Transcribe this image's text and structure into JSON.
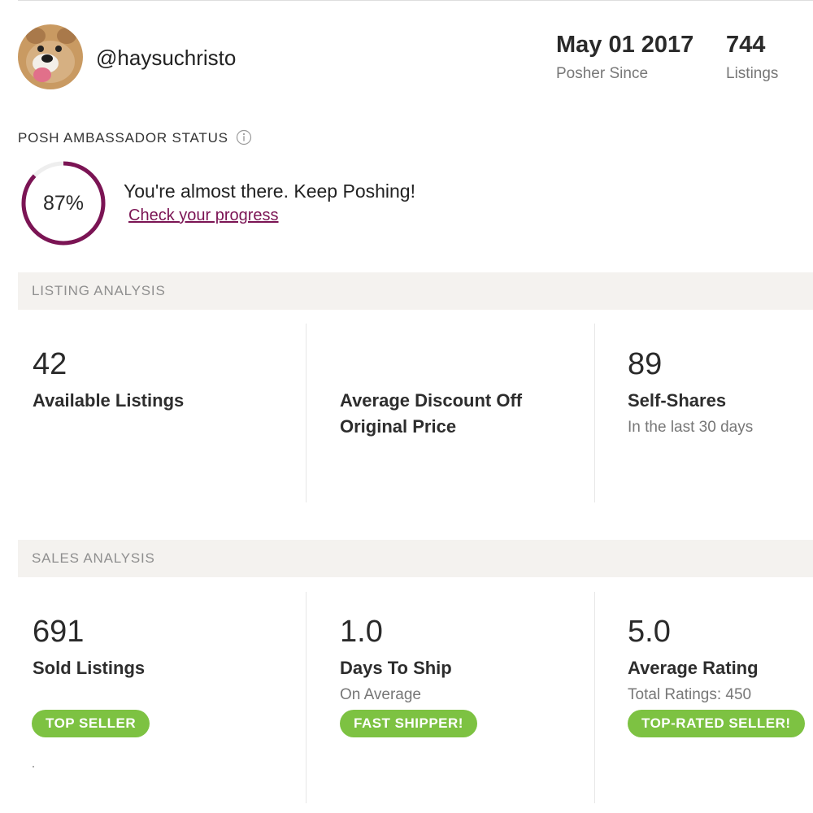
{
  "profile": {
    "username": "@haysuchristo",
    "posher_since_value": "May 01 2017",
    "posher_since_label": "Posher Since",
    "listings_value": "744",
    "listings_label": "Listings"
  },
  "ambassador": {
    "title": "POSH AMBASSADOR STATUS",
    "progress_percent": 87,
    "progress_text": "87%",
    "message": "You're almost there. Keep Poshing!",
    "link": "Check your progress",
    "accent_color": "#7b1454"
  },
  "listing_analysis": {
    "header": "LISTING ANALYSIS",
    "available_value": "42",
    "available_label": "Available Listings",
    "discount_label_line1": "Average Discount Off",
    "discount_label_line2": "Original Price",
    "self_shares_value": "89",
    "self_shares_label": "Self-Shares",
    "self_shares_sub": "In the last 30 days"
  },
  "sales_analysis": {
    "header": "SALES ANALYSIS",
    "sold_value": "691",
    "sold_label": "Sold Listings",
    "sold_badge": "TOP SELLER",
    "ship_value": "1.0",
    "ship_label": "Days To Ship",
    "ship_sub": "On Average",
    "ship_badge": "FAST SHIPPER!",
    "rating_value": "5.0",
    "rating_label": "Average Rating",
    "rating_sub": "Total Ratings: 450",
    "rating_badge": "TOP-RATED SELLER!",
    "badge_color": "#7dc242"
  }
}
